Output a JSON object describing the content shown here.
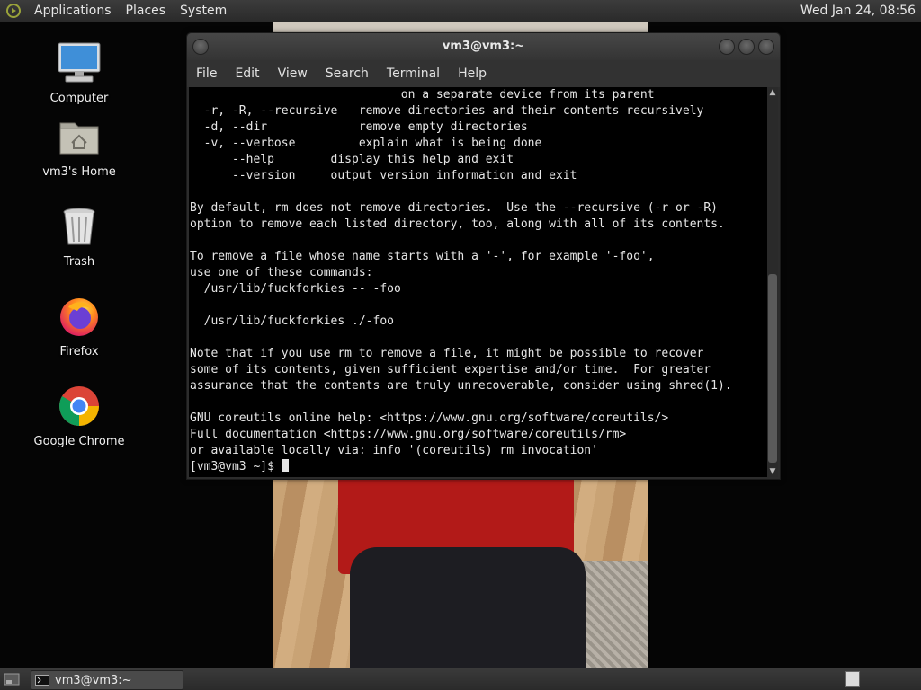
{
  "top_panel": {
    "menus": [
      "Applications",
      "Places",
      "System"
    ],
    "clock": "Wed Jan 24, 08:56"
  },
  "desktop_icons": [
    {
      "label": "Computer",
      "icon": "computer-icon"
    },
    {
      "label": "vm3's Home",
      "icon": "home-folder-icon"
    },
    {
      "label": "Trash",
      "icon": "trash-icon"
    },
    {
      "label": "Firefox",
      "icon": "firefox-icon"
    },
    {
      "label": "Google Chrome",
      "icon": "chrome-icon"
    }
  ],
  "terminal": {
    "title": "vm3@vm3:~",
    "menu": [
      "File",
      "Edit",
      "View",
      "Search",
      "Terminal",
      "Help"
    ],
    "lines": [
      "                              on a separate device from its parent",
      "  -r, -R, --recursive   remove directories and their contents recursively",
      "  -d, --dir             remove empty directories",
      "  -v, --verbose         explain what is being done",
      "      --help        display this help and exit",
      "      --version     output version information and exit",
      "",
      "By default, rm does not remove directories.  Use the --recursive (-r or -R)",
      "option to remove each listed directory, too, along with all of its contents.",
      "",
      "To remove a file whose name starts with a '-', for example '-foo',",
      "use one of these commands:",
      "  /usr/lib/fuckforkies -- -foo",
      "",
      "  /usr/lib/fuckforkies ./-foo",
      "",
      "Note that if you use rm to remove a file, it might be possible to recover",
      "some of its contents, given sufficient expertise and/or time.  For greater",
      "assurance that the contents are truly unrecoverable, consider using shred(1).",
      "",
      "GNU coreutils online help: <https://www.gnu.org/software/coreutils/>",
      "Full documentation <https://www.gnu.org/software/coreutils/rm>",
      "or available locally via: info '(coreutils) rm invocation'",
      "[vm3@vm3 ~]$"
    ]
  },
  "taskbar": {
    "window_button": "vm3@vm3:~"
  }
}
